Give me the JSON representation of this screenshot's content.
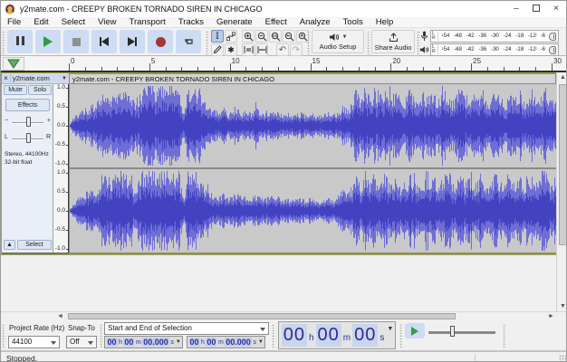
{
  "window": {
    "title": "y2mate.com - CREEPY BROKEN TORNADO SIREN IN CHICAGO",
    "minimize": "–",
    "close": "×"
  },
  "menu": {
    "items": [
      "File",
      "Edit",
      "Select",
      "View",
      "Transport",
      "Tracks",
      "Generate",
      "Effect",
      "Analyze",
      "Tools",
      "Help"
    ]
  },
  "toolbar": {
    "audio_setup_label": "Audio Setup",
    "share_audio_label": "Share Audio",
    "undo_glyph": "↶",
    "redo_glyph": "↷",
    "ibeam_glyph": "I",
    "multitool_glyph": "✱"
  },
  "meters": {
    "channels": [
      "L",
      "R"
    ],
    "scale": [
      "-54",
      "-48",
      "-42",
      "-36",
      "-30",
      "-24",
      "-18",
      "-12",
      "-6"
    ]
  },
  "timeline": {
    "total_seconds": 30,
    "label_every": 5,
    "labels": [
      "0",
      "5",
      "10",
      "15",
      "20",
      "25",
      "30"
    ]
  },
  "track": {
    "close": "×",
    "name": "y2mate.com",
    "dropdown": "▼",
    "clip_title": "y2mate.com - CREEPY BROKEN TORNADO SIREN IN CHICAGO",
    "mute": "Mute",
    "solo": "Solo",
    "effects": "Effects",
    "gain_min": "−",
    "gain_max": "+",
    "pan_left": "L",
    "pan_right": "R",
    "info1": "Stereo, 44100Hz",
    "info2": "32-bit float",
    "collapse": "▲",
    "select": "Select",
    "scale_labels": [
      "1.0",
      "0.5",
      "0.0",
      "-0.5",
      "-1.0"
    ]
  },
  "waveform": {
    "color_peak": "#6e6ed6",
    "color_rms": "#4343c2",
    "background": "#c9c9c9",
    "seed": 12,
    "envelope": [
      0.05,
      0.2,
      0.35,
      0.42,
      0.46,
      0.5,
      0.55,
      0.75,
      0.88,
      0.7,
      0.92,
      0.78,
      0.9,
      0.72,
      0.6,
      0.68,
      0.95,
      0.97,
      0.95,
      0.97,
      0.96,
      0.97,
      0.95,
      0.96,
      0.95,
      0.3,
      0.95,
      0.97,
      0.92,
      0.65,
      0.52,
      0.45,
      0.4,
      0.35,
      0.42,
      0.3,
      0.38,
      0.45,
      0.32,
      0.38,
      0.3,
      0.42,
      0.35,
      0.28,
      0.38,
      0.3,
      0.34,
      0.26,
      0.3,
      0.24,
      0.28,
      0.32,
      0.25,
      0.3,
      0.26,
      0.24,
      0.28,
      0.32,
      0.26,
      0.35,
      0.5,
      0.42,
      0.55,
      0.85,
      0.6,
      0.95,
      0.7,
      0.88,
      0.65,
      0.92,
      0.75,
      0.6,
      0.85,
      0.55,
      0.7,
      0.95,
      0.65,
      0.58,
      0.8,
      0.68,
      0.9,
      0.62,
      0.75,
      0.88,
      0.6,
      0.7,
      0.95,
      0.65,
      0.78,
      0.6,
      0.72,
      0.85,
      0.62,
      0.75,
      0.9,
      0.68,
      0.6,
      0.82,
      0.7,
      0.92,
      0.65,
      0.75,
      0.85,
      0.62,
      0.78,
      0.9,
      0.68,
      0.72
    ]
  },
  "selection_toolbar": {
    "project_rate_label": "Project Rate (Hz)",
    "project_rate_value": "44100",
    "snap_label": "Snap-To",
    "snap_value": "Off",
    "mode": "Start and End of Selection",
    "time_field": {
      "h": "00",
      "h_unit": "h",
      "m": "00",
      "m_unit": "m",
      "s": "00.000",
      "s_unit": "s"
    },
    "big_time": {
      "h": "00",
      "h_unit": "h",
      "m": "00",
      "m_unit": "m",
      "s": "00",
      "s_unit": "s"
    }
  },
  "status": {
    "text": "Stopped."
  }
}
